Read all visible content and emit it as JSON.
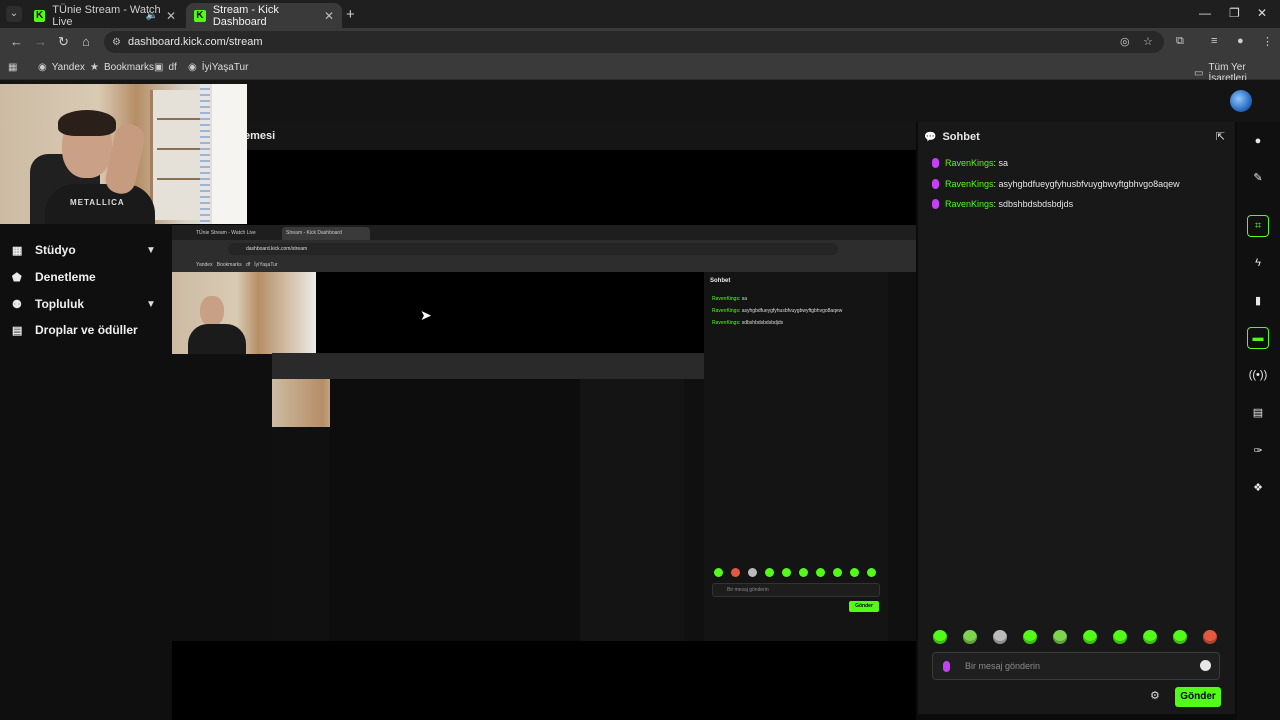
{
  "browser": {
    "tabs": [
      {
        "label": "TÜnie Stream - Watch Live"
      },
      {
        "label": "Stream - Kick Dashboard"
      }
    ],
    "url": "dashboard.kick.com/stream",
    "bookmarks": [
      {
        "label": "Yandex"
      },
      {
        "label": "Bookmarks"
      },
      {
        "label": "df"
      },
      {
        "label": "İyiYaşaTur"
      }
    ],
    "all_bookmarks": "Tüm Yer İşaretleri"
  },
  "sidebar": {
    "items": [
      {
        "label": "Stüdyo",
        "icon": "studio-icon",
        "chevron": true
      },
      {
        "label": "Denetleme",
        "icon": "shield-icon",
        "chevron": false
      },
      {
        "label": "Topluluk",
        "icon": "community-icon",
        "chevron": true
      },
      {
        "label": "Droplar ve ödüller",
        "icon": "drops-icon",
        "chevron": false
      }
    ]
  },
  "stream": {
    "header_partial": "emesi",
    "webcam_shirt": "METALLICA"
  },
  "chat": {
    "title": "Sohbet",
    "messages": [
      {
        "user": "RavenKings",
        "text": "sa"
      },
      {
        "user": "RavenKings",
        "text": "asyhgbdfueygfyhusbfvuygbwyftgbhvgo8aqew"
      },
      {
        "user": "RavenKings",
        "text": "sdbshbdsbdsbdjds"
      }
    ],
    "placeholder": "Bir mesaj gönderin",
    "send_label": "Gönder"
  },
  "colors": {
    "accent": "#53fc18",
    "mic": "#c53ff5"
  }
}
